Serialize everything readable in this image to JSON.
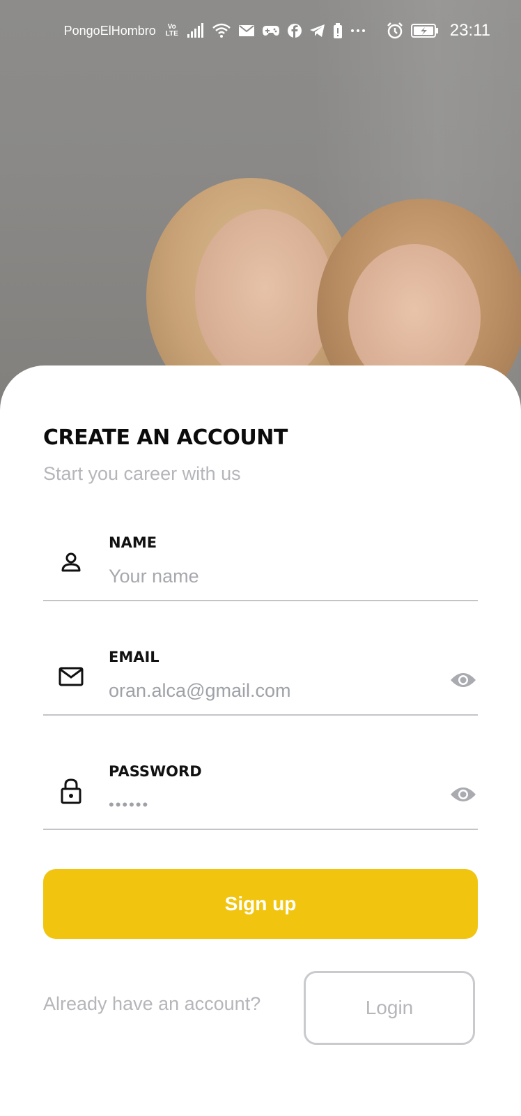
{
  "status_bar": {
    "carrier": "PongoElHombro",
    "network_badge": "Vo LTE",
    "time": "23:11",
    "icons": [
      "signal-icon",
      "wifi-icon",
      "mail-icon",
      "gamepad-icon",
      "facebook-icon",
      "telegram-icon",
      "battery-saver-icon",
      "more-dots-icon",
      "alarm-icon",
      "battery-charging-icon"
    ]
  },
  "hero": {
    "image": "photo-two-smiling-women"
  },
  "form": {
    "title": "CREATE AN ACCOUNT",
    "subtitle": "Start you career with us",
    "name": {
      "label": "NAME",
      "placeholder": "Your name",
      "value": "",
      "icon": "person-icon"
    },
    "email": {
      "label": "EMAIL",
      "placeholder": "",
      "value": "oran.alca@gmail.com",
      "icon": "mail-icon"
    },
    "password": {
      "label": "PASSWORD",
      "placeholder": "",
      "value": "••••••",
      "icon": "lock-icon"
    },
    "signup_label": "Sign up",
    "already_text": "Already have an account?",
    "login_label": "Login"
  },
  "colors": {
    "accent": "#f1c40f",
    "muted_text": "#b5b6ba",
    "divider": "#c2c4c8",
    "title_text": "#0b0b0b"
  }
}
